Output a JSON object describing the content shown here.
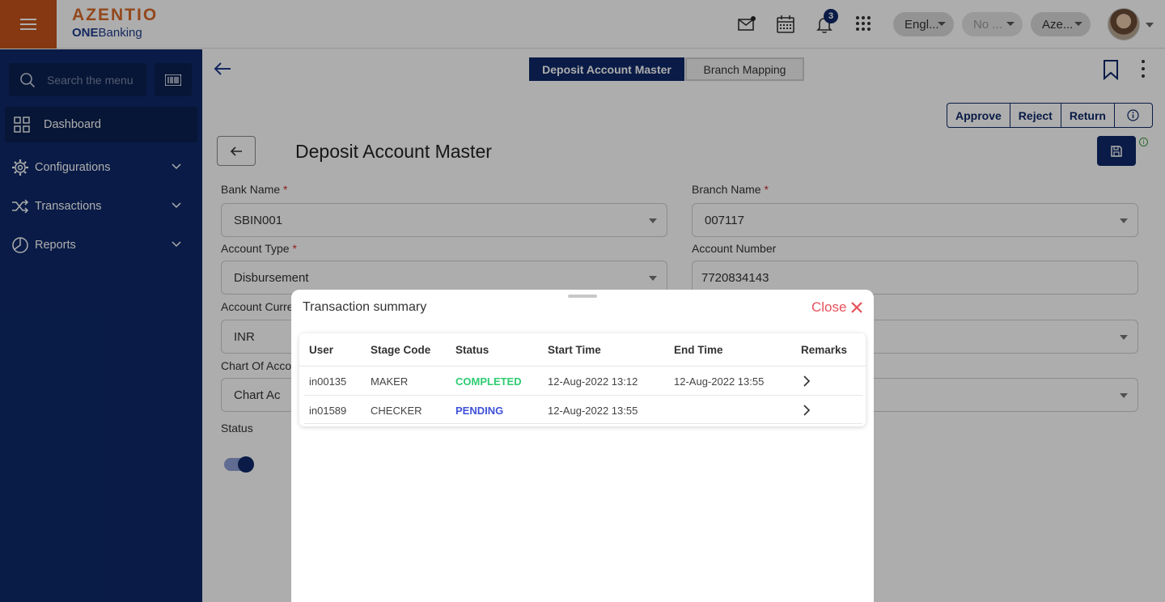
{
  "brand": {
    "name": "AZENTIO",
    "product_prefix": "ONE",
    "product_suffix": "Banking"
  },
  "header": {
    "notification_count": "3",
    "language": "Engl...",
    "second_select": "No ...",
    "third_select": "Aze...",
    "colors": {
      "brand_orange": "#c4531a",
      "navy": "#0e2868"
    }
  },
  "sidebar": {
    "search_placeholder": "Search the menu",
    "items": [
      {
        "label": "Dashboard",
        "icon": "dashboard-grid-icon"
      },
      {
        "label": "Configurations",
        "icon": "gear-icon"
      },
      {
        "label": "Transactions",
        "icon": "shuffle-icon"
      },
      {
        "label": "Reports",
        "icon": "pie-chart-icon"
      }
    ]
  },
  "tabs": [
    {
      "label": "Deposit Account Master"
    },
    {
      "label": "Branch Mapping"
    }
  ],
  "actions": {
    "approve": "Approve",
    "reject": "Reject",
    "return": "Return"
  },
  "form": {
    "title": "Deposit Account Master",
    "bank_name": {
      "label": "Bank Name",
      "value": "SBIN001"
    },
    "branch_name": {
      "label": "Branch Name",
      "value": "007117"
    },
    "account_type": {
      "label": "Account Type",
      "value": "Disbursement"
    },
    "account_number": {
      "label": "Account Number",
      "value": "7720834143"
    },
    "account_currency": {
      "label": "Account Curre",
      "value": "INR"
    },
    "chart_of_account": {
      "label": "Chart Of Acco",
      "value": "Chart Ac"
    },
    "status": {
      "label": "Status"
    }
  },
  "modal": {
    "title": "Transaction summary",
    "close_label": "Close",
    "columns": [
      "User",
      "Stage Code",
      "Status",
      "Start Time",
      "End Time",
      "Remarks"
    ],
    "rows": [
      {
        "user": "in00135",
        "stage_code": "MAKER",
        "status": "COMPLETED",
        "start_time": "12-Aug-2022 13:12",
        "end_time": "12-Aug-2022 13:55"
      },
      {
        "user": "in01589",
        "stage_code": "CHECKER",
        "status": "PENDING",
        "start_time": "12-Aug-2022 13:55",
        "end_time": ""
      }
    ]
  }
}
